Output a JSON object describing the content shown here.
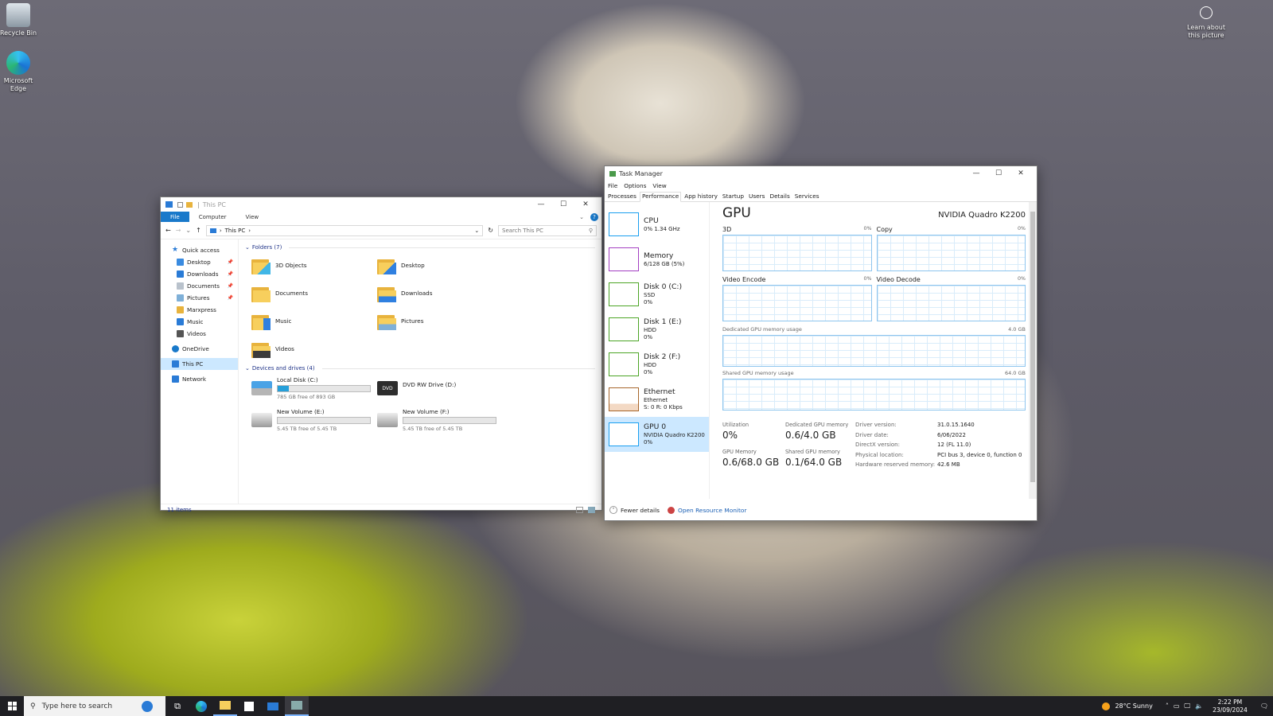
{
  "desktop": {
    "icons": [
      {
        "label": "Recycle Bin"
      },
      {
        "label": "Microsoft Edge"
      }
    ],
    "learn": {
      "label": "Learn about this picture"
    }
  },
  "explorer": {
    "title": "This PC",
    "ribbon_tabs": [
      "File",
      "Computer",
      "View"
    ],
    "address": "This PC",
    "search_placeholder": "Search This PC",
    "nav": {
      "quick_access": "Quick access",
      "items": [
        "Desktop",
        "Downloads",
        "Documents",
        "Pictures",
        "Marxpress",
        "Music",
        "Videos"
      ],
      "onedrive": "OneDrive",
      "thispc": "This PC",
      "network": "Network"
    },
    "folders_header": "Folders (7)",
    "folders": [
      "3D Objects",
      "Desktop",
      "Documents",
      "Downloads",
      "Music",
      "Pictures",
      "Videos"
    ],
    "drives_header": "Devices and drives (4)",
    "drives": [
      {
        "name": "Local Disk (C:)",
        "free": "785 GB free of 893 GB",
        "used_fraction": 0.12
      },
      {
        "name": "DVD RW Drive (D:)",
        "free": "",
        "used_fraction": null
      },
      {
        "name": "New Volume (E:)",
        "free": "5.45 TB free of 5.45 TB",
        "used_fraction": 0.0
      },
      {
        "name": "New Volume (F:)",
        "free": "5.45 TB free of 5.45 TB",
        "used_fraction": 0.0
      }
    ],
    "status": "11 items",
    "dvd_label": "DVD"
  },
  "taskmgr": {
    "title": "Task Manager",
    "menu": [
      "File",
      "Options",
      "View"
    ],
    "tabs": [
      "Processes",
      "Performance",
      "App history",
      "Startup",
      "Users",
      "Details",
      "Services"
    ],
    "list": [
      {
        "name": "CPU",
        "l1": "0% 1.34 GHz",
        "l2": "",
        "color": "#1a9ff0"
      },
      {
        "name": "Memory",
        "l1": "6/128 GB (5%)",
        "l2": "",
        "color": "#a33fc2"
      },
      {
        "name": "Disk 0 (C:)",
        "l1": "SSD",
        "l2": "0%",
        "color": "#4ca526"
      },
      {
        "name": "Disk 1 (E:)",
        "l1": "HDD",
        "l2": "0%",
        "color": "#4ca526"
      },
      {
        "name": "Disk 2 (F:)",
        "l1": "HDD",
        "l2": "0%",
        "color": "#4ca526"
      },
      {
        "name": "Ethernet",
        "l1": "Ethernet",
        "l2": "S: 0 R: 0 Kbps",
        "color": "#a7662b"
      },
      {
        "name": "GPU 0",
        "l1": "NVIDIA Quadro K2200",
        "l2": "0%",
        "color": "#1a9ff0"
      }
    ],
    "gpu": {
      "title": "GPU",
      "model": "NVIDIA Quadro K2200",
      "engines": [
        {
          "label": "3D",
          "pct": "0%"
        },
        {
          "label": "Copy",
          "pct": "0%"
        },
        {
          "label": "Video Encode",
          "pct": "0%"
        },
        {
          "label": "Video Decode",
          "pct": "0%"
        }
      ],
      "dedicated_label": "Dedicated GPU memory usage",
      "dedicated_max": "4.0 GB",
      "shared_label": "Shared GPU memory usage",
      "shared_max": "64.0 GB",
      "stats": [
        {
          "label": "Utilization",
          "value": "0%"
        },
        {
          "label": "Dedicated GPU memory",
          "value": "0.6/4.0 GB"
        },
        {
          "label": "GPU Memory",
          "value": "0.6/68.0 GB"
        },
        {
          "label": "Shared GPU memory",
          "value": "0.1/64.0 GB"
        }
      ],
      "info": [
        {
          "k": "Driver version:",
          "v": "31.0.15.1640"
        },
        {
          "k": "Driver date:",
          "v": "6/06/2022"
        },
        {
          "k": "DirectX version:",
          "v": "12 (FL 11.0)"
        },
        {
          "k": "Physical location:",
          "v": "PCI bus 3, device 0, function 0"
        },
        {
          "k": "Hardware reserved memory:",
          "v": "42.6 MB"
        }
      ]
    },
    "fewer_details": "Fewer details",
    "resource_monitor": "Open Resource Monitor"
  },
  "taskbar": {
    "search_placeholder": "Type here to search",
    "weather": "28°C  Sunny",
    "time": "2:22 PM",
    "date": "23/09/2024"
  }
}
